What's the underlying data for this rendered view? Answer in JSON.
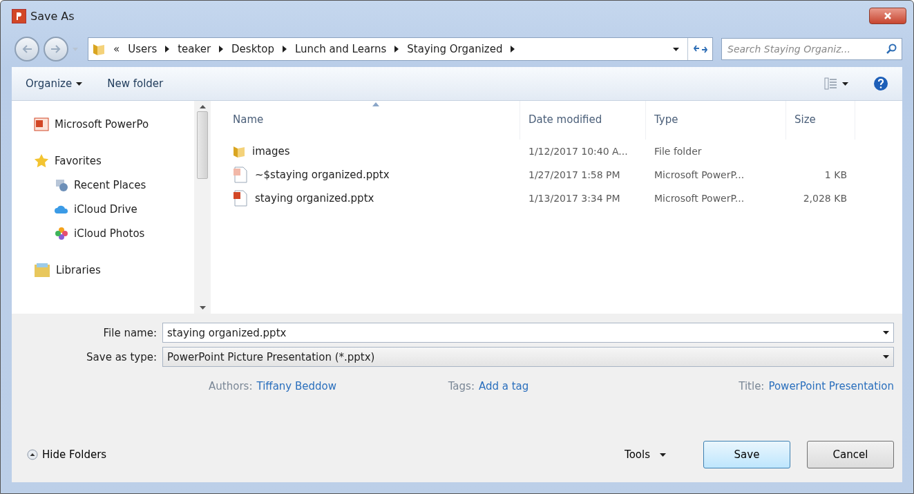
{
  "window": {
    "title": "Save As"
  },
  "address": {
    "overflow": "«",
    "crumbs": [
      "Users",
      "teaker",
      "Desktop",
      "Lunch and Learns",
      "Staying Organized"
    ]
  },
  "search": {
    "placeholder": "Search Staying Organiz..."
  },
  "toolbar": {
    "buttons": [
      {
        "label": "Organize",
        "dropdown": true
      },
      {
        "label": "New folder",
        "dropdown": false
      }
    ]
  },
  "sidebar": {
    "items": [
      {
        "kind": "app",
        "label": "Microsoft PowerPo"
      },
      {
        "kind": "favorites",
        "label": "Favorites",
        "children": [
          {
            "kind": "recent",
            "label": "Recent Places"
          },
          {
            "kind": "cloud",
            "label": "iCloud Drive"
          },
          {
            "kind": "photos",
            "label": "iCloud Photos"
          }
        ]
      },
      {
        "kind": "libraries",
        "label": "Libraries"
      }
    ]
  },
  "file_list": {
    "columns": [
      {
        "label": "Name",
        "sorted": true
      },
      {
        "label": "Date modified",
        "sorted": false
      },
      {
        "label": "Type",
        "sorted": false
      },
      {
        "label": "Size",
        "sorted": false
      }
    ],
    "rows": [
      {
        "kind": "folder",
        "name": "images",
        "date": "1/12/2017 10:40 A...",
        "type": "File folder"
      },
      {
        "kind": "temp",
        "name": "~$staying organized.pptx",
        "date": "1/27/2017 1:58 PM",
        "type": "Microsoft PowerP...",
        "size": "1 KB"
      },
      {
        "kind": "pptx",
        "name": "staying organized.pptx",
        "date": "1/13/2017 3:34 PM",
        "type": "Microsoft PowerP...",
        "size": "2,028 KB"
      }
    ]
  },
  "form": {
    "file_name": {
      "label": "File name:",
      "value": "staying organized.pptx"
    },
    "save_as_type": {
      "label": "Save as type:",
      "value": "PowerPoint Picture Presentation (*.pptx)"
    }
  },
  "properties": [
    {
      "label": "Authors:",
      "value": "Tiffany Beddow"
    },
    {
      "label": "Tags:",
      "value": "Add a tag"
    },
    {
      "label": "Title:",
      "value": "PowerPoint Presentation"
    }
  ],
  "footer": {
    "hide_folders": "Hide Folders",
    "tools": "Tools",
    "save": "Save",
    "cancel": "Cancel"
  }
}
